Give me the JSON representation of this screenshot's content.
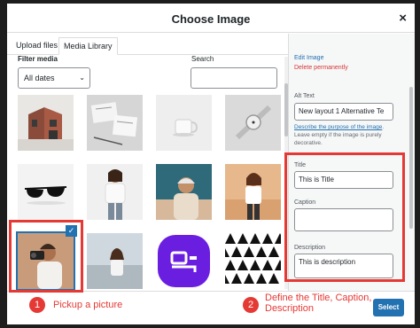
{
  "modal": {
    "title": "Choose Image",
    "close_symbol": "×"
  },
  "tabs": [
    {
      "label": "Upload files"
    },
    {
      "label": "Media Library"
    }
  ],
  "filters": {
    "filter_label": "Filter media",
    "date_select_value": "All dates",
    "search_label": "Search",
    "search_value": ""
  },
  "thumbnails": [
    {
      "subject": "building",
      "bg": "#e8e6e3"
    },
    {
      "subject": "sketches",
      "bg": "#dcdcdc"
    },
    {
      "subject": "cup",
      "bg": "#ececec"
    },
    {
      "subject": "watch",
      "bg": "#d9d9d9"
    },
    {
      "subject": "sunglasses",
      "bg": "#f2f2f2"
    },
    {
      "subject": "woman-shirt",
      "bg": "#f1f1f1"
    },
    {
      "subject": "man-cap",
      "bg": "#c9a48a"
    },
    {
      "subject": "woman-sunset",
      "bg": "#e0b58e"
    },
    {
      "subject": "man-camera",
      "bg": "#c89b7a"
    },
    {
      "subject": "woman-beach",
      "bg": "#cfd6dc"
    },
    {
      "subject": "purple-logo",
      "bg": "#6a1ee0"
    },
    {
      "subject": "triangle-pattern",
      "bg": "#ffffff"
    }
  ],
  "sidebar": {
    "edit_link": "Edit Image",
    "delete_link": "Delete permanently",
    "alt_label": "Alt Text",
    "alt_value": "New layout 1 Alternative Te",
    "alt_help_link": "Describe the purpose of the image",
    "alt_help_text": ". Leave empty if the image is purely decorative.",
    "title_label": "Title",
    "title_value": "This is Title",
    "caption_label": "Caption",
    "caption_value": "",
    "description_label": "Description",
    "description_value": "This is description"
  },
  "footer": {
    "select_label": "Select"
  },
  "annotations": {
    "step1_number": "1",
    "step1_text": "Pickup a picture",
    "step2_number": "2",
    "step2_text_line1": "Define the Title, Caption,",
    "step2_text_line2": "Description",
    "highlight_color": "#e53935"
  }
}
